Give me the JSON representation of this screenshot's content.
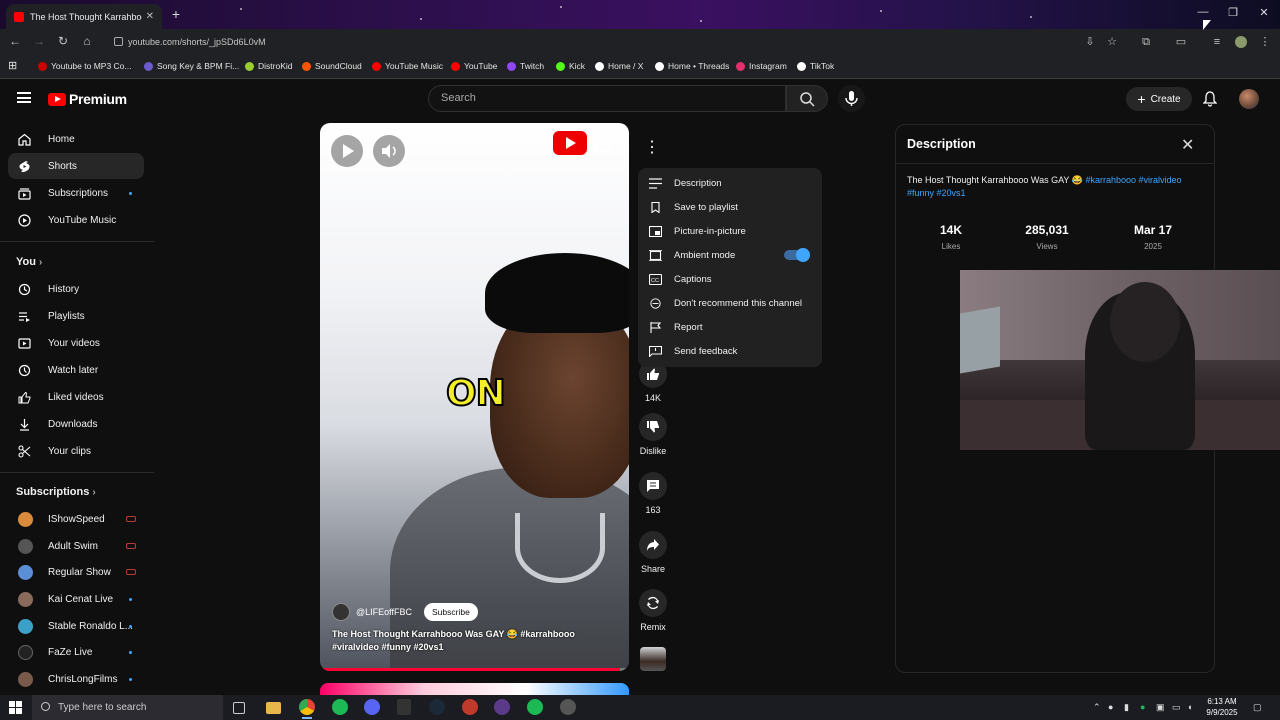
{
  "browser": {
    "tab_title": "The Host Thought Karrahbooo",
    "url": "youtube.com/shorts/_jpSDd6L0vM",
    "bookmarks": [
      {
        "label": "Youtube to MP3 Co...",
        "color": "#c00"
      },
      {
        "label": "Song Key & BPM Fi...",
        "color": "#6a5acd"
      },
      {
        "label": "DistroKid",
        "color": "#9acd32"
      },
      {
        "label": "SoundCloud",
        "color": "#ff5500"
      },
      {
        "label": "YouTube Music",
        "color": "#ff0000"
      },
      {
        "label": "YouTube",
        "color": "#ff0000"
      },
      {
        "label": "Twitch",
        "color": "#9146ff"
      },
      {
        "label": "Kick",
        "color": "#53fc18"
      },
      {
        "label": "Home / X",
        "color": "#ffffff"
      },
      {
        "label": "Home • Threads",
        "color": "#ffffff"
      },
      {
        "label": "Instagram",
        "color": "#e1306c"
      },
      {
        "label": "TikTok",
        "color": "#ffffff"
      }
    ]
  },
  "header": {
    "logo_text": "Premium",
    "search_placeholder": "Search",
    "create_label": "Create"
  },
  "sidebar": {
    "main": [
      {
        "label": "Home",
        "icon": "home-icon"
      },
      {
        "label": "Shorts",
        "icon": "shorts-icon",
        "active": true
      },
      {
        "label": "Subscriptions",
        "icon": "subscriptions-icon"
      },
      {
        "label": "YouTube Music",
        "icon": "youtube-music-icon"
      }
    ],
    "you_heading": "You",
    "you": [
      {
        "label": "History",
        "icon": "history-icon"
      },
      {
        "label": "Playlists",
        "icon": "playlists-icon"
      },
      {
        "label": "Your videos",
        "icon": "your-videos-icon"
      },
      {
        "label": "Watch later",
        "icon": "watch-later-icon"
      },
      {
        "label": "Liked videos",
        "icon": "liked-videos-icon"
      },
      {
        "label": "Downloads",
        "icon": "downloads-icon"
      },
      {
        "label": "Your clips",
        "icon": "clips-icon"
      }
    ],
    "subs_heading": "Subscriptions",
    "subscriptions": [
      {
        "label": "IShowSpeed",
        "color": "#d98a3a",
        "status": "live"
      },
      {
        "label": "Adult Swim",
        "color": "#555555",
        "status": "live"
      },
      {
        "label": "Regular Show",
        "color": "#5a8fd8",
        "status": "live"
      },
      {
        "label": "Kai Cenat Live",
        "color": "#8a6a5a",
        "status": "new"
      },
      {
        "label": "Stable Ronaldo L...",
        "color": "#3aa0c8",
        "status": "new"
      },
      {
        "label": "FaZe Live",
        "color": "#222222",
        "status": "new"
      },
      {
        "label": "ChrisLongFilms",
        "color": "#7a5a4a",
        "status": "new"
      }
    ]
  },
  "short": {
    "overlay_text": "ON",
    "channel": "@LIFEoffFBC",
    "subscribe_label": "Subscribe",
    "title": "The Host Thought Karrahbooo Was GAY 😂 #karrahbooo #viralvideo #funny #20vs1",
    "progress": 0.97
  },
  "actions": {
    "likes": "14K",
    "dislike_label": "Dislike",
    "comments": "163",
    "share_label": "Share",
    "remix_label": "Remix"
  },
  "menu": {
    "items": [
      {
        "label": "Description",
        "icon": "description-icon"
      },
      {
        "label": "Save to playlist",
        "icon": "bookmark-icon"
      },
      {
        "label": "Picture-in-picture",
        "icon": "pip-icon"
      },
      {
        "label": "Ambient mode",
        "icon": "ambient-icon",
        "toggle": true
      },
      {
        "label": "Captions",
        "icon": "captions-icon"
      },
      {
        "label": "Don't recommend this channel",
        "icon": "block-icon"
      },
      {
        "label": "Report",
        "icon": "flag-icon"
      },
      {
        "label": "Send feedback",
        "icon": "feedback-icon"
      }
    ]
  },
  "description": {
    "heading": "Description",
    "text_plain": "The Host Thought Karrahbooo Was GAY 😂 ",
    "text_tags": "#karrahbooo #viralvideo #funny #20vs1",
    "stats": [
      {
        "value": "14K",
        "label": "Likes"
      },
      {
        "value": "285,031",
        "label": "Views"
      },
      {
        "value": "Mar 17",
        "label": "2025"
      }
    ]
  },
  "taskbar": {
    "search_placeholder": "Type here to search",
    "time": "6:13 AM",
    "date": "9/9/2025"
  }
}
